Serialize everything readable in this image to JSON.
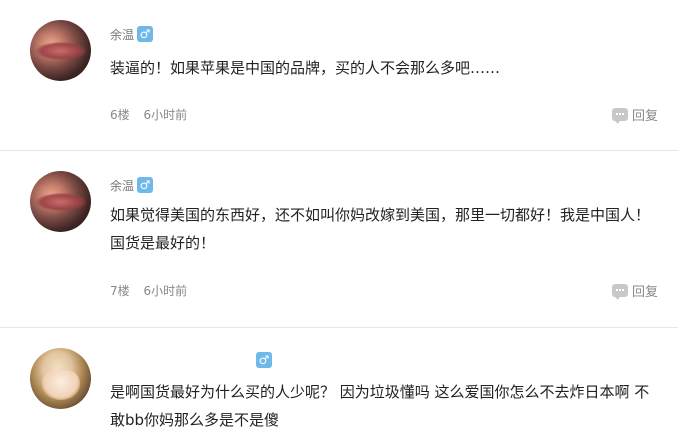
{
  "comments": [
    {
      "username": "余温",
      "gender_symbol": "♂",
      "text": "装逼的！如果苹果是中国的品牌，买的人不会那么多吧……",
      "floor": "6楼",
      "time": "6小时前",
      "reply_label": "回复",
      "avatar": "lips-avatar"
    },
    {
      "username": "余温",
      "gender_symbol": "♂",
      "text": "如果觉得美国的东西好，还不如叫你妈改嫁到美国，那里一切都好！我是中国人！国货是最好的！",
      "floor": "7楼",
      "time": "6小时前",
      "reply_label": "回复",
      "avatar": "lips-avatar"
    },
    {
      "username": "",
      "gender_symbol": "♂",
      "text": "是啊国货最好为什么买的人少呢？ 因为垃圾懂吗 这么爱国你怎么不去炸日本啊 不敢bb你妈那么多是不是傻",
      "avatar": "anime-avatar"
    }
  ],
  "colors": {
    "gender_badge": "#6fb9e8",
    "divider": "#e6e6e6"
  }
}
